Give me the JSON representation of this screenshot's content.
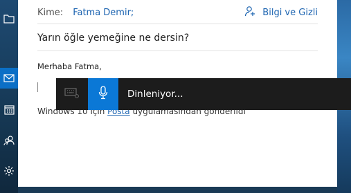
{
  "compose": {
    "to_label": "Kime:",
    "to_value": "Fatma Demir;",
    "info_label": "Bilgi ve Gizli",
    "subject": "Yarın öğle yemeğine ne dersin?",
    "greeting": "Merhaba Fatma,",
    "signature_before": "Windows 10 için ",
    "signature_link": "Posta",
    "signature_after": " uygulamasından gönderildi"
  },
  "dictation": {
    "status": "Dinleniyor..."
  },
  "sidebar": {
    "icons": [
      "folder-icon",
      "mail-icon",
      "calendar-icon",
      "people-icon",
      "settings-icon"
    ],
    "active": "mail-icon"
  },
  "colors": {
    "accent": "#0b78d6",
    "link": "#1b63b0",
    "dictation_bg": "#1c1c1c"
  }
}
